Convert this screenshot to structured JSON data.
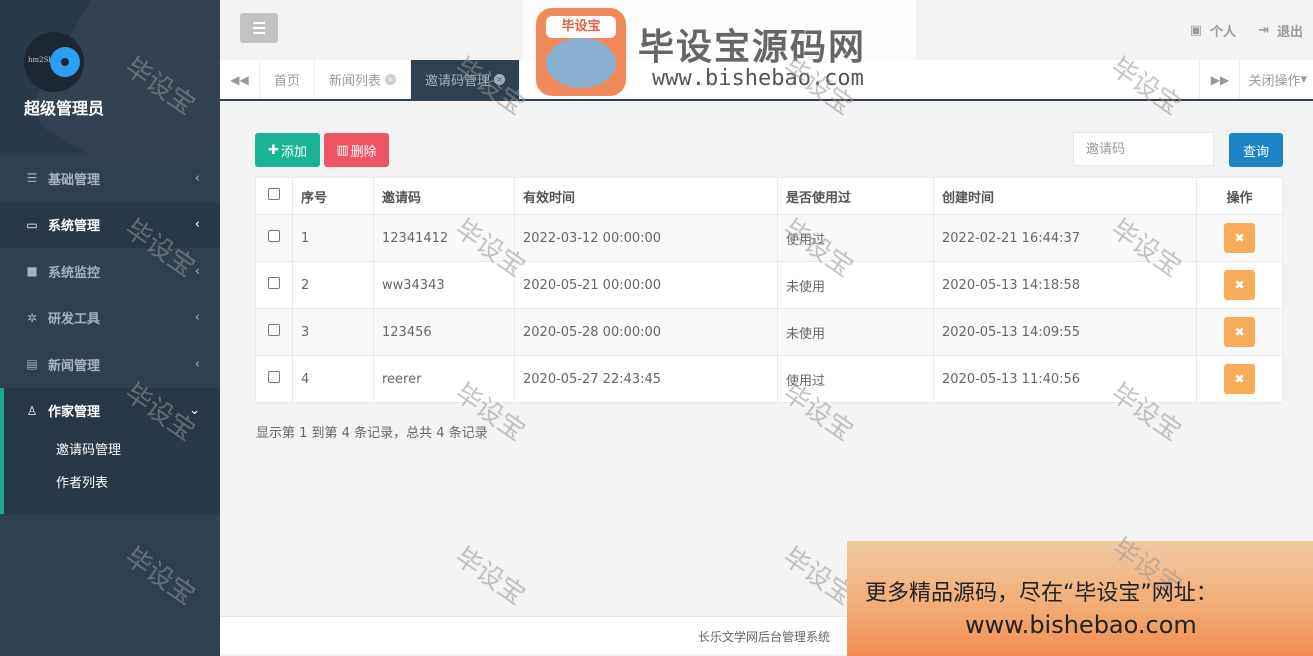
{
  "sidebar": {
    "avatar_text": "hm2Sb",
    "admin_name": "超级管理员",
    "menu": [
      {
        "label": "基础管理",
        "icon": "list-icon"
      },
      {
        "label": "系统管理",
        "icon": "monitor-icon"
      },
      {
        "label": "系统监控",
        "icon": "video-icon"
      },
      {
        "label": "研发工具",
        "icon": "gear-icon"
      },
      {
        "label": "新闻管理",
        "icon": "newspaper-icon"
      },
      {
        "label": "作家管理",
        "icon": "user-icon"
      }
    ],
    "submenu": [
      {
        "label": "邀请码管理"
      },
      {
        "label": "作者列表"
      }
    ]
  },
  "topbar": {
    "personal": "个人",
    "logout": "退出"
  },
  "tabs": {
    "items": [
      {
        "label": "首页"
      },
      {
        "label": "新闻列表"
      },
      {
        "label": "邀请码管理"
      }
    ],
    "close_ops": "关闭操作"
  },
  "toolbar": {
    "add_label": "添加",
    "delete_label": "删除",
    "search_placeholder": "邀请码",
    "query_label": "查询"
  },
  "table": {
    "headers": [
      "序号",
      "邀请码",
      "有效时间",
      "是否使用过",
      "创建时间",
      "操作"
    ],
    "rows": [
      {
        "no": "1",
        "code": "12341412",
        "valid": "2022-03-12 00:00:00",
        "used": "使用过",
        "created": "2022-02-21 16:44:37"
      },
      {
        "no": "2",
        "code": "ww34343",
        "valid": "2020-05-21 00:00:00",
        "used": "未使用",
        "created": "2020-05-13 14:18:58"
      },
      {
        "no": "3",
        "code": "123456",
        "valid": "2020-05-28 00:00:00",
        "used": "未使用",
        "created": "2020-05-13 14:09:55"
      },
      {
        "no": "4",
        "code": "reerer",
        "valid": "2020-05-27 22:43:45",
        "used": "使用过",
        "created": "2020-05-13 11:40:56"
      }
    ]
  },
  "pager_info": "显示第 1 到第 4 条记录，总共 4 条记录",
  "footer_text": "长乐文学网后台管理系统",
  "watermark": {
    "logo_tag": "毕设宝",
    "title": "毕设宝源码网",
    "url": "www.bishebao.com",
    "stamp": "毕设宝",
    "promo_line1": "更多精品源码，尽在“毕设宝”网址：",
    "promo_line2": "www.bishebao.com"
  }
}
